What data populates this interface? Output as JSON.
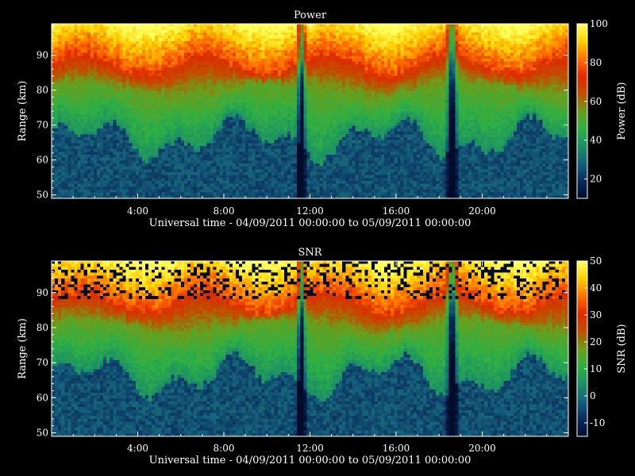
{
  "chart_data": [
    {
      "type": "heatmap",
      "title": "Power",
      "xlabel": "Universal time - 04/09/2011 00:00:00 to 05/09/2011 00:00:00",
      "ylabel": "Range (km)",
      "x_ticks": [
        "4:00",
        "8:00",
        "12:00",
        "16:00",
        "20:00"
      ],
      "x_tick_hours": [
        4,
        8,
        12,
        16,
        20
      ],
      "xlim_hours": [
        0,
        24
      ],
      "y_ticks": [
        50,
        60,
        70,
        80,
        90
      ],
      "ylim": [
        49,
        99
      ],
      "colorbar": {
        "label": "Power (dB)",
        "ticks": [
          20,
          40,
          60,
          80,
          100
        ],
        "range": [
          10,
          100
        ]
      },
      "colormap": [
        "#000c2a",
        "#0a2a5c",
        "#14607a",
        "#1a8f66",
        "#2fb043",
        "#6a9f1c",
        "#c05000",
        "#e02800",
        "#ff7000",
        "#ffd000",
        "#ffff60"
      ]
    },
    {
      "type": "heatmap",
      "title": "SNR",
      "xlabel": "Universal time - 04/09/2011 00:00:00 to 05/09/2011 00:00:00",
      "ylabel": "Range (km)",
      "x_ticks": [
        "4:00",
        "8:00",
        "12:00",
        "16:00",
        "20:00"
      ],
      "x_tick_hours": [
        4,
        8,
        12,
        16,
        20
      ],
      "xlim_hours": [
        0,
        24
      ],
      "y_ticks": [
        50,
        60,
        70,
        80,
        90
      ],
      "ylim": [
        49,
        99
      ],
      "colorbar": {
        "label": "SNR (dB)",
        "ticks": [
          -10,
          0,
          10,
          20,
          30,
          40,
          50
        ],
        "range": [
          -15,
          50
        ]
      },
      "colormap": [
        "#000c2a",
        "#0a2a5c",
        "#14607a",
        "#1a8f66",
        "#2fb043",
        "#6a9f1c",
        "#c05000",
        "#e02800",
        "#ff7000",
        "#ffd000",
        "#ffff60"
      ]
    }
  ]
}
